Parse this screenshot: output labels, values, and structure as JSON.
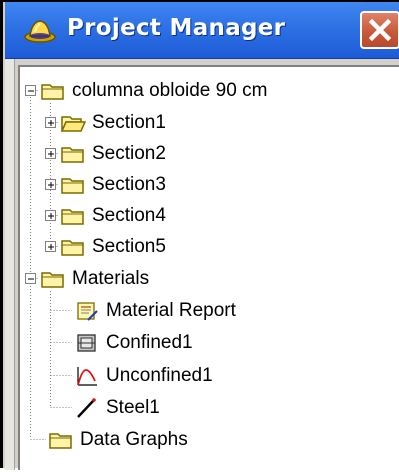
{
  "window": {
    "title": "Project Manager",
    "title_icon": "project-manager-icon",
    "close_icon": "close-icon"
  },
  "tree": {
    "root": {
      "label": "columna obloide 90 cm",
      "icon": "folder-icon",
      "expanded": true,
      "sections": [
        {
          "label": "Section1",
          "icon": "open-folder-icon",
          "expanded": false
        },
        {
          "label": "Section2",
          "icon": "folder-icon",
          "expanded": false
        },
        {
          "label": "Section3",
          "icon": "folder-icon",
          "expanded": false
        },
        {
          "label": "Section4",
          "icon": "folder-icon",
          "expanded": false
        },
        {
          "label": "Section5",
          "icon": "folder-icon",
          "expanded": false
        }
      ]
    },
    "materials": {
      "label": "Materials",
      "icon": "folder-icon",
      "expanded": true,
      "items": [
        {
          "label": "Material Report",
          "icon": "report-icon"
        },
        {
          "label": "Confined1",
          "icon": "confined-material-icon"
        },
        {
          "label": "Unconfined1",
          "icon": "unconfined-curve-icon"
        },
        {
          "label": "Steel1",
          "icon": "steel-line-icon"
        }
      ]
    },
    "data_graphs": {
      "label": "Data Graphs",
      "icon": "folder-icon"
    }
  },
  "colors": {
    "titlebar": "#2f73e6",
    "close_button": "#c85a3c",
    "folder_fill": "#fff3a8",
    "folder_stroke": "#7a6a00"
  }
}
